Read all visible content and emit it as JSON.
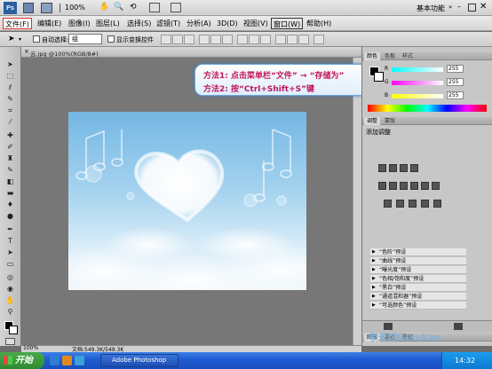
{
  "appbar": {
    "zoom": "100%",
    "workspace": "基本功能"
  },
  "menu": [
    {
      "label": "文件(F)",
      "hl": true
    },
    {
      "label": "编辑(E)"
    },
    {
      "label": "图像(I)"
    },
    {
      "label": "图层(L)"
    },
    {
      "label": "选择(S)"
    },
    {
      "label": "滤镜(T)"
    },
    {
      "label": "分析(A)"
    },
    {
      "label": "3D(D)"
    },
    {
      "label": "视图(V)"
    },
    {
      "label": "窗口(W)"
    },
    {
      "label": "帮助(H)"
    }
  ],
  "options": {
    "auto_select": "自动选择:",
    "auto_select_value": "组",
    "show_transform": "显示变换控件"
  },
  "document": {
    "tab_title": "云.jpg @100%(RGB/8#)",
    "zoom": "100%",
    "doc_info": "文档:549.3K/549.3K"
  },
  "callout": {
    "line1": "方法1: 点击菜单栏“文件” → “存储为”",
    "line2": "方法2: 按“Ctrl+Shift+S”键"
  },
  "color_panel": {
    "tabs": [
      "颜色",
      "色板",
      "样式"
    ],
    "r_label": "R",
    "g_label": "G",
    "b_label": "B",
    "r_value": "255",
    "g_value": "255",
    "b_value": "255"
  },
  "adjust_panel": {
    "tabs": [
      "调整",
      "蒙版"
    ],
    "title": "添加调整",
    "presets": [
      "“色阶”预设",
      "“曲线”预设",
      "“曝光度”预设",
      "“色相/饱和度”预设",
      "“黑白”预设",
      "“通道混和器”预设",
      "“可选颜色”预设"
    ]
  },
  "layers_panel": {
    "tabs": [
      "图层",
      "通道",
      "路径"
    ]
  },
  "taskbar": {
    "start": "开始",
    "item": "Adobe Photoshop",
    "time": "14:32"
  },
  "watermark": "考无忧Easykao"
}
